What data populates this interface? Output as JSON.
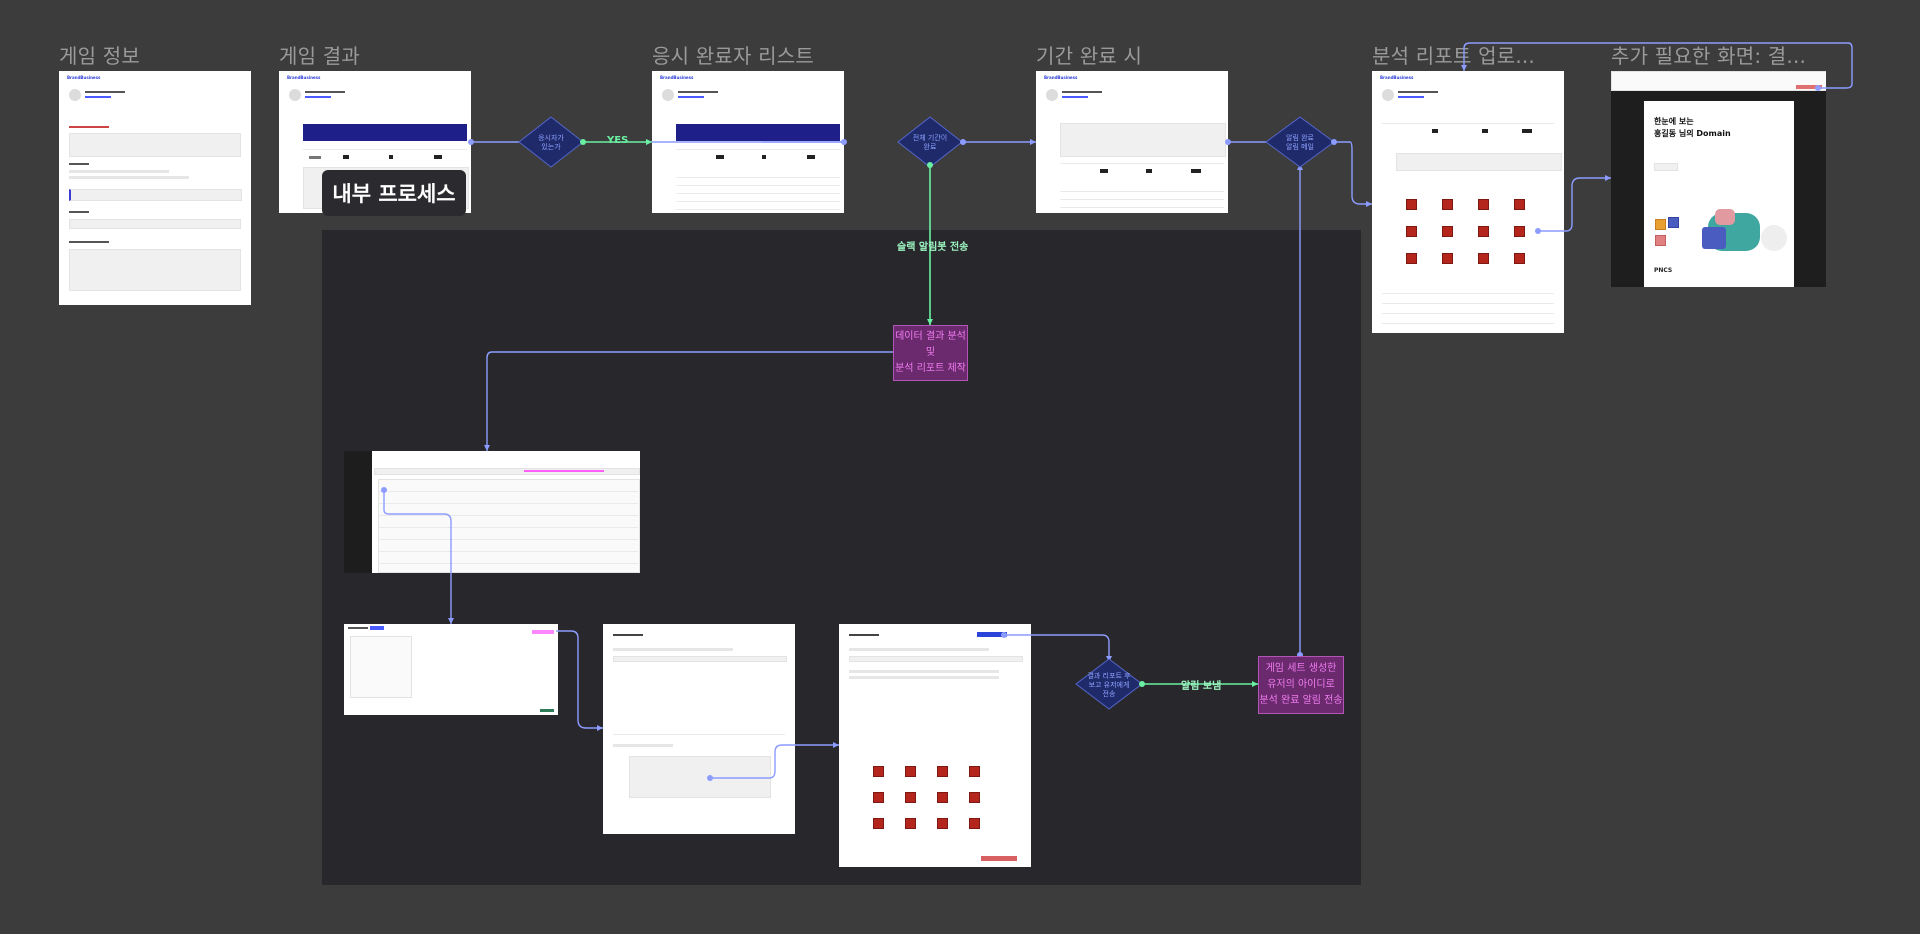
{
  "frames": {
    "game_info": {
      "title": "게임 정보"
    },
    "game_result": {
      "title": "게임 결과"
    },
    "completer_list": {
      "title": "응시 완료자 리스트"
    },
    "period_end": {
      "title": "기간 완료 시"
    },
    "report_upload": {
      "title": "분석 리포트 업로..."
    },
    "extra_screen": {
      "title": "추가 필요한 화면: 결..."
    }
  },
  "badge": {
    "label": "내부 프로세스"
  },
  "decisions": {
    "has_examinee": "응시자가\n있는가",
    "period_end": "전체 기간이\n완료",
    "alert_send": "알림 완료\n알림 메일",
    "report_done": "결과 리포트 후\n보고 유저에게\n전송"
  },
  "edges": {
    "yes": "YES",
    "slack_bot": "슬랙 알림봇 전송",
    "notify": "알림 보냄"
  },
  "processes": {
    "analysis": "데이터 결과 분석\n및\n분석 리포트 제작",
    "send_result": "게임 세트 생성한\n유저의 아이디로\n분석 완료 알림 전송"
  },
  "mini": {
    "logo": "BrandBusiness",
    "domain_name": "Domain 진단 테스트",
    "extra_heading": "한눈에 보는\n홍길동 님의 Domain",
    "extra_footer": "PNCS"
  },
  "colors": {
    "background": "#3c3c3c",
    "panel": "#28282c",
    "wire": "#8c9cff",
    "yes_wire": "#6af0a2",
    "process": "#6b2a6e",
    "diamond": "#1f2a6b"
  }
}
